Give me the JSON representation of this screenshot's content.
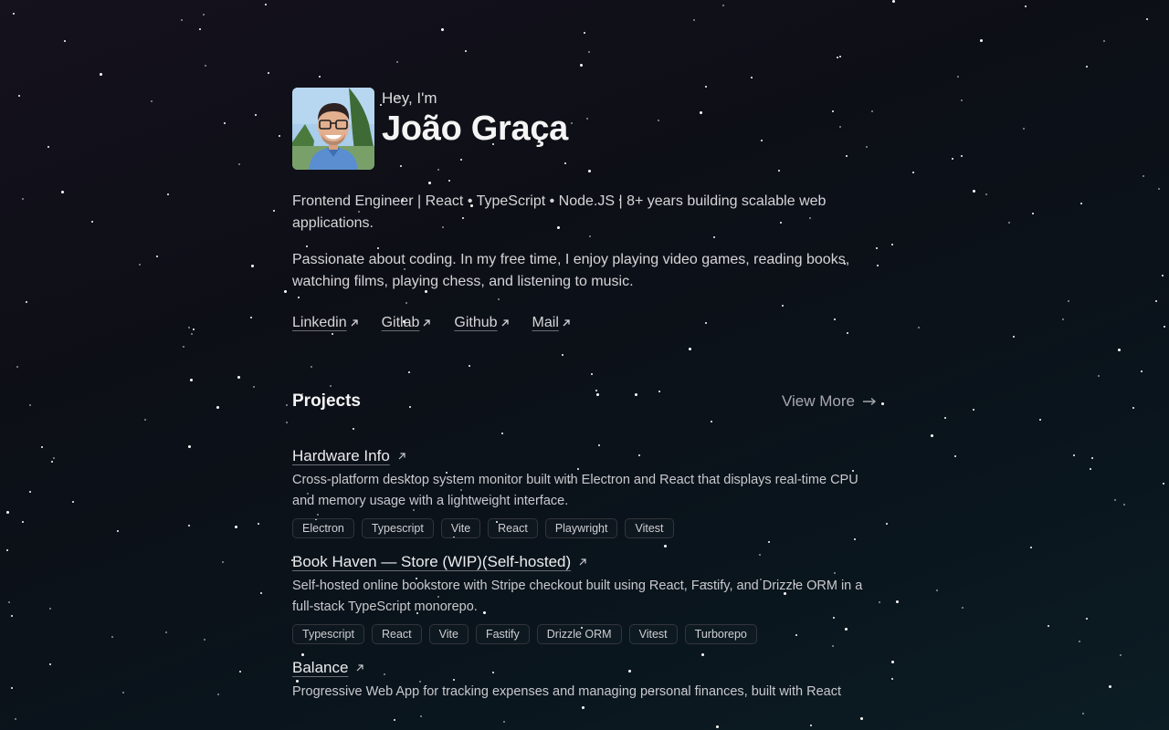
{
  "hero": {
    "greeting": "Hey, I'm",
    "name": "João Graça"
  },
  "bio": {
    "headline": "Frontend Engineer | React • TypeScript • Node.JS | 8+ years building scalable web applications.",
    "about": "Passionate about coding. In my free time, I enjoy playing video games, reading books, watching films, playing chess, and listening to music."
  },
  "social": [
    {
      "label": "Linkedin"
    },
    {
      "label": "Gitlab"
    },
    {
      "label": "Github"
    },
    {
      "label": "Mail"
    }
  ],
  "projects": {
    "title": "Projects",
    "view_more": "View More",
    "items": [
      {
        "title": "Hardware Info",
        "description": "Cross-platform desktop system monitor built with Electron and React that displays real-time CPU and memory usage with a lightweight interface.",
        "tags": [
          "Electron",
          "Typescript",
          "Vite",
          "React",
          "Playwright",
          "Vitest"
        ]
      },
      {
        "title": "Book Haven — Store (WIP)(Self-hosted)",
        "description": "Self-hosted online bookstore with Stripe checkout built using React, Fastify, and Drizzle ORM in a full-stack TypeScript monorepo.",
        "tags": [
          "Typescript",
          "React",
          "Vite",
          "Fastify",
          "Drizzle ORM",
          "Vitest",
          "Turborepo"
        ]
      },
      {
        "title": "Balance",
        "description": "Progressive Web App for tracking expenses and managing personal finances, built with React",
        "tags": []
      }
    ]
  },
  "colors": {
    "background_start": "#15111d",
    "background_end": "#0c1d24",
    "text_primary": "#f4f4f5",
    "text_secondary": "#d6d6d9",
    "tag_border": "#33343b"
  },
  "icons": {
    "external_link": "arrow-up-right-icon",
    "view_more": "arrow-right-icon",
    "avatar": "profile-photo"
  }
}
